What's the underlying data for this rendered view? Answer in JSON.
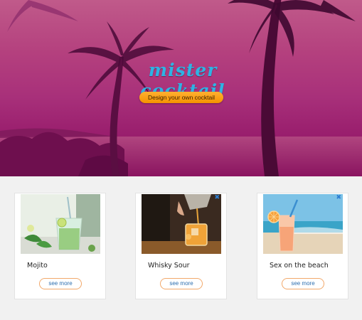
{
  "hero": {
    "brand": "mister cocktail",
    "cta_label": "Design your own cocktail"
  },
  "cocktails": [
    {
      "name": "Mojito",
      "button": "see more"
    },
    {
      "name": "Whisky Sour",
      "button": "see more"
    },
    {
      "name": "Sex on the beach",
      "button": "see more"
    }
  ],
  "colors": {
    "brand_blue": "#2fb3e4",
    "cta_orange": "#f59300",
    "hero_tint": "#a8307a",
    "link_blue": "#2d6fb0"
  },
  "icons": {
    "card_close": "close-icon"
  }
}
